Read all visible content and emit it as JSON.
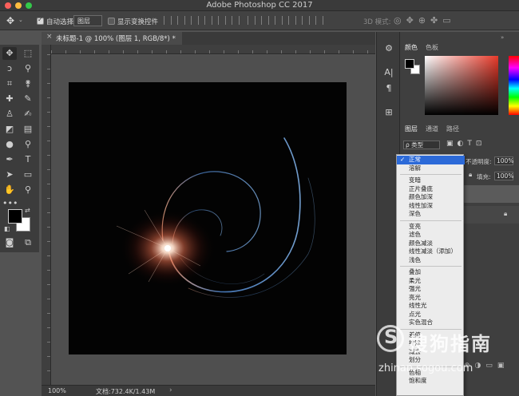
{
  "window": {
    "title": "Adobe Photoshop CC 2017"
  },
  "options_bar": {
    "auto_select_label": "自动选择:",
    "auto_select_value": "图层",
    "show_transform_label": "显示变换控件",
    "mode_3d_label": "3D 模式:"
  },
  "document": {
    "tab_title": "未标题-1 @ 100% (图层 1, RGB/8*) *",
    "zoom": "100%",
    "doc_info": "文档:732.4K/1.43M"
  },
  "colors": {
    "accent": "#2c6ad8",
    "flare": "#ffb08a",
    "arc": "#4a7fc4"
  },
  "color_panel": {
    "tabs": [
      "颜色",
      "色板"
    ]
  },
  "layers_panel": {
    "tabs": [
      "图层",
      "通道",
      "路径"
    ],
    "filter_label": "ρ 类型",
    "opacity_label": "不透明度:",
    "opacity_value": "100%",
    "fill_label": "填充:",
    "fill_value": "100%"
  },
  "blend_menu": {
    "selected": "正常",
    "groups": [
      [
        "正常",
        "溶解"
      ],
      [
        "变暗",
        "正片叠底",
        "颜色加深",
        "线性加深",
        "深色"
      ],
      [
        "变亮",
        "滤色",
        "颜色减淡",
        "线性减淡（添加）",
        "浅色"
      ],
      [
        "叠加",
        "柔光",
        "强光",
        "亮光",
        "线性光",
        "点光",
        "实色混合"
      ],
      [
        "差值",
        "排除",
        "减去",
        "划分"
      ],
      [
        "色相",
        "饱和度"
      ]
    ]
  },
  "watermark": {
    "brand": "搜狗指南",
    "url": "zhinan.sogou.com"
  }
}
